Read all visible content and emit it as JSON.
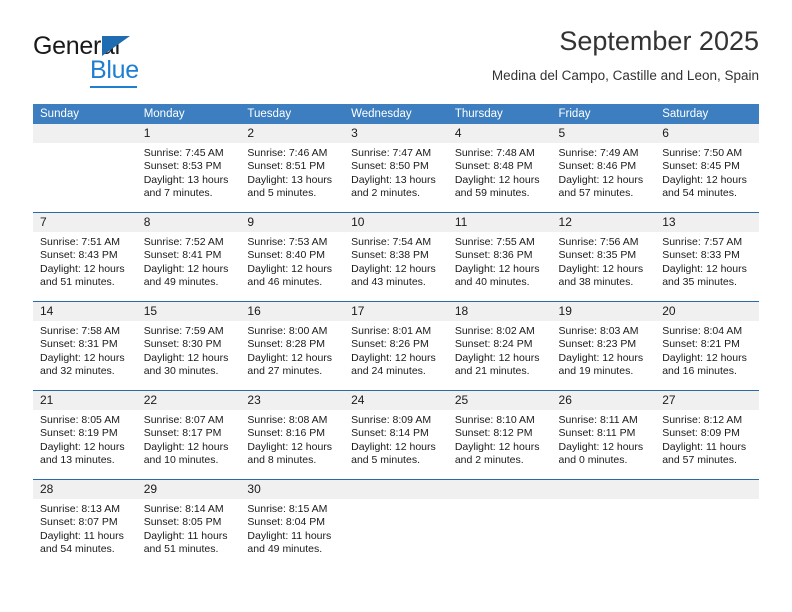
{
  "brand": {
    "name_part1": "General",
    "name_part2": "Blue",
    "triangle_color": "#1f6cb0",
    "blue_color": "#1f7ed0"
  },
  "header": {
    "title": "September 2025",
    "subtitle": "Medina del Campo, Castille and Leon, Spain"
  },
  "theme": {
    "header_row_bg": "#3c7ebf",
    "row_divider": "#2a6aa8",
    "daynum_bg": "#f0f0f0"
  },
  "weekdays": [
    "Sunday",
    "Monday",
    "Tuesday",
    "Wednesday",
    "Thursday",
    "Friday",
    "Saturday"
  ],
  "weeks": [
    [
      {
        "day": "",
        "lines": []
      },
      {
        "day": "1",
        "lines": [
          "Sunrise: 7:45 AM",
          "Sunset: 8:53 PM",
          "Daylight: 13 hours",
          "and 7 minutes."
        ]
      },
      {
        "day": "2",
        "lines": [
          "Sunrise: 7:46 AM",
          "Sunset: 8:51 PM",
          "Daylight: 13 hours",
          "and 5 minutes."
        ]
      },
      {
        "day": "3",
        "lines": [
          "Sunrise: 7:47 AM",
          "Sunset: 8:50 PM",
          "Daylight: 13 hours",
          "and 2 minutes."
        ]
      },
      {
        "day": "4",
        "lines": [
          "Sunrise: 7:48 AM",
          "Sunset: 8:48 PM",
          "Daylight: 12 hours",
          "and 59 minutes."
        ]
      },
      {
        "day": "5",
        "lines": [
          "Sunrise: 7:49 AM",
          "Sunset: 8:46 PM",
          "Daylight: 12 hours",
          "and 57 minutes."
        ]
      },
      {
        "day": "6",
        "lines": [
          "Sunrise: 7:50 AM",
          "Sunset: 8:45 PM",
          "Daylight: 12 hours",
          "and 54 minutes."
        ]
      }
    ],
    [
      {
        "day": "7",
        "lines": [
          "Sunrise: 7:51 AM",
          "Sunset: 8:43 PM",
          "Daylight: 12 hours",
          "and 51 minutes."
        ]
      },
      {
        "day": "8",
        "lines": [
          "Sunrise: 7:52 AM",
          "Sunset: 8:41 PM",
          "Daylight: 12 hours",
          "and 49 minutes."
        ]
      },
      {
        "day": "9",
        "lines": [
          "Sunrise: 7:53 AM",
          "Sunset: 8:40 PM",
          "Daylight: 12 hours",
          "and 46 minutes."
        ]
      },
      {
        "day": "10",
        "lines": [
          "Sunrise: 7:54 AM",
          "Sunset: 8:38 PM",
          "Daylight: 12 hours",
          "and 43 minutes."
        ]
      },
      {
        "day": "11",
        "lines": [
          "Sunrise: 7:55 AM",
          "Sunset: 8:36 PM",
          "Daylight: 12 hours",
          "and 40 minutes."
        ]
      },
      {
        "day": "12",
        "lines": [
          "Sunrise: 7:56 AM",
          "Sunset: 8:35 PM",
          "Daylight: 12 hours",
          "and 38 minutes."
        ]
      },
      {
        "day": "13",
        "lines": [
          "Sunrise: 7:57 AM",
          "Sunset: 8:33 PM",
          "Daylight: 12 hours",
          "and 35 minutes."
        ]
      }
    ],
    [
      {
        "day": "14",
        "lines": [
          "Sunrise: 7:58 AM",
          "Sunset: 8:31 PM",
          "Daylight: 12 hours",
          "and 32 minutes."
        ]
      },
      {
        "day": "15",
        "lines": [
          "Sunrise: 7:59 AM",
          "Sunset: 8:30 PM",
          "Daylight: 12 hours",
          "and 30 minutes."
        ]
      },
      {
        "day": "16",
        "lines": [
          "Sunrise: 8:00 AM",
          "Sunset: 8:28 PM",
          "Daylight: 12 hours",
          "and 27 minutes."
        ]
      },
      {
        "day": "17",
        "lines": [
          "Sunrise: 8:01 AM",
          "Sunset: 8:26 PM",
          "Daylight: 12 hours",
          "and 24 minutes."
        ]
      },
      {
        "day": "18",
        "lines": [
          "Sunrise: 8:02 AM",
          "Sunset: 8:24 PM",
          "Daylight: 12 hours",
          "and 21 minutes."
        ]
      },
      {
        "day": "19",
        "lines": [
          "Sunrise: 8:03 AM",
          "Sunset: 8:23 PM",
          "Daylight: 12 hours",
          "and 19 minutes."
        ]
      },
      {
        "day": "20",
        "lines": [
          "Sunrise: 8:04 AM",
          "Sunset: 8:21 PM",
          "Daylight: 12 hours",
          "and 16 minutes."
        ]
      }
    ],
    [
      {
        "day": "21",
        "lines": [
          "Sunrise: 8:05 AM",
          "Sunset: 8:19 PM",
          "Daylight: 12 hours",
          "and 13 minutes."
        ]
      },
      {
        "day": "22",
        "lines": [
          "Sunrise: 8:07 AM",
          "Sunset: 8:17 PM",
          "Daylight: 12 hours",
          "and 10 minutes."
        ]
      },
      {
        "day": "23",
        "lines": [
          "Sunrise: 8:08 AM",
          "Sunset: 8:16 PM",
          "Daylight: 12 hours",
          "and 8 minutes."
        ]
      },
      {
        "day": "24",
        "lines": [
          "Sunrise: 8:09 AM",
          "Sunset: 8:14 PM",
          "Daylight: 12 hours",
          "and 5 minutes."
        ]
      },
      {
        "day": "25",
        "lines": [
          "Sunrise: 8:10 AM",
          "Sunset: 8:12 PM",
          "Daylight: 12 hours",
          "and 2 minutes."
        ]
      },
      {
        "day": "26",
        "lines": [
          "Sunrise: 8:11 AM",
          "Sunset: 8:11 PM",
          "Daylight: 12 hours",
          "and 0 minutes."
        ]
      },
      {
        "day": "27",
        "lines": [
          "Sunrise: 8:12 AM",
          "Sunset: 8:09 PM",
          "Daylight: 11 hours",
          "and 57 minutes."
        ]
      }
    ],
    [
      {
        "day": "28",
        "lines": [
          "Sunrise: 8:13 AM",
          "Sunset: 8:07 PM",
          "Daylight: 11 hours",
          "and 54 minutes."
        ]
      },
      {
        "day": "29",
        "lines": [
          "Sunrise: 8:14 AM",
          "Sunset: 8:05 PM",
          "Daylight: 11 hours",
          "and 51 minutes."
        ]
      },
      {
        "day": "30",
        "lines": [
          "Sunrise: 8:15 AM",
          "Sunset: 8:04 PM",
          "Daylight: 11 hours",
          "and 49 minutes."
        ]
      },
      {
        "day": "",
        "lines": []
      },
      {
        "day": "",
        "lines": []
      },
      {
        "day": "",
        "lines": []
      },
      {
        "day": "",
        "lines": []
      }
    ]
  ]
}
